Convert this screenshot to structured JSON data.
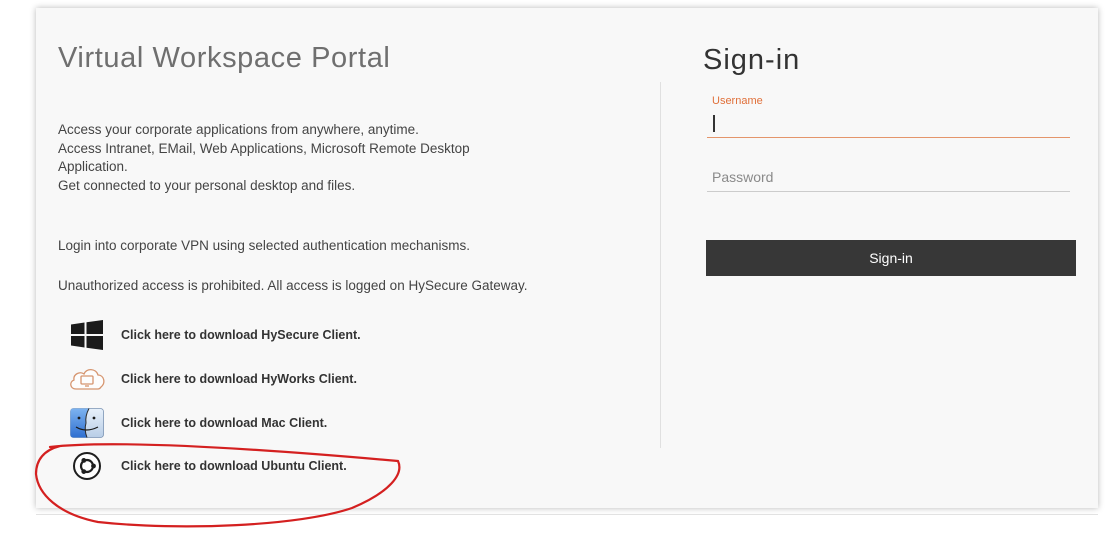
{
  "portal": {
    "title": "Virtual Workspace Portal",
    "description_lines": [
      "Access your corporate applications from anywhere, anytime.",
      "Access Intranet, EMail, Web Applications, Microsoft Remote Desktop",
      "Application.",
      "Get connected to your personal desktop and files."
    ],
    "vpn_line": "Login into corporate VPN using selected authentication mechanisms.",
    "warning_line": "Unauthorized access is prohibited. All access is logged on HySecure Gateway."
  },
  "downloads": [
    {
      "label": "Click here to download HySecure Client.",
      "icon": "windows-logo-icon"
    },
    {
      "label": "Click here to download HyWorks Client.",
      "icon": "cloud-monitor-icon"
    },
    {
      "label": "Click here to download Mac Client.",
      "icon": "mac-finder-icon"
    },
    {
      "label": "Click here to download Ubuntu Client.",
      "icon": "ubuntu-logo-icon"
    }
  ],
  "signin": {
    "title": "Sign-in",
    "username_label": "Username",
    "username_value": "",
    "password_placeholder": "Password",
    "password_value": "",
    "button_label": "Sign-in"
  },
  "colors": {
    "accent": "#e0703a",
    "button_bg": "#373737",
    "annotation": "#d42020"
  }
}
